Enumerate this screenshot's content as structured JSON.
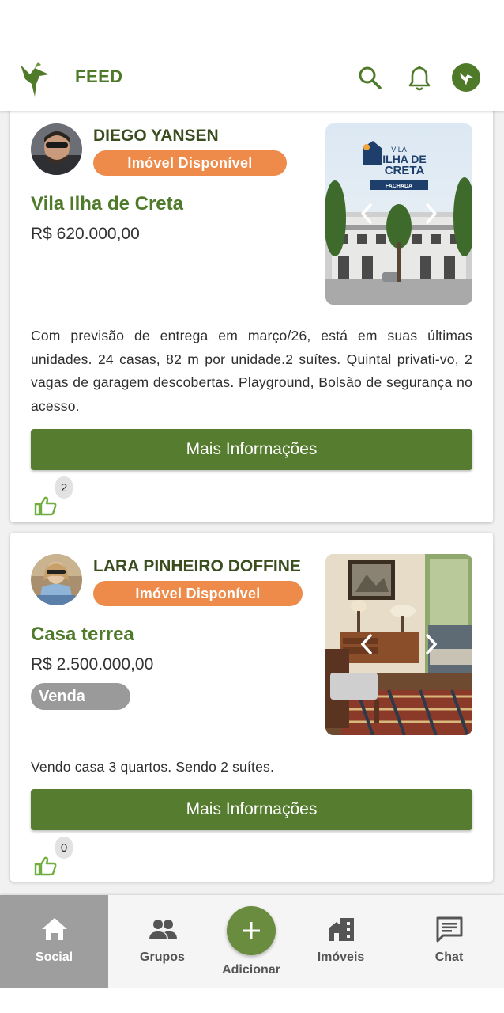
{
  "header": {
    "title": "FEED",
    "logo_icon": "hummingbird-logo",
    "search_icon": "search-icon",
    "notifications_icon": "bell-icon",
    "profile_icon": "profile-avatar-icon"
  },
  "posts": [
    {
      "author": "DIEGO YANSEN",
      "badge": "Imóvel Disponível",
      "title": "Vila Ilha de Creta",
      "price": "R$ 620.000,00",
      "photo_caption_small": "VILA",
      "photo_caption_large1": "ILHA DE",
      "photo_caption_large2": "CRETA",
      "photo_tag": "FACHADA",
      "description": "Com previsão de entrega em março/26, está em suas últimas unidades. 24 casas, 82 m por unidade.2 suítes. Quintal privati-vo, 2 vagas de garagem descobertas. Playground, Bolsão de segurança no acesso.",
      "button_label": "Mais Informações",
      "likes": "2"
    },
    {
      "author": "LARA PINHEIRO DOFFINE",
      "badge": "Imóvel Disponível",
      "title": "Casa terrea",
      "price": "R$ 2.500.000,00",
      "deal_type": "Venda",
      "description": "Vendo casa 3 quartos. Sendo 2 suítes.",
      "button_label": "Mais Informações",
      "likes": "0"
    }
  ],
  "bottom_nav": {
    "social": "Social",
    "grupos": "Grupos",
    "adicionar": "Adicionar",
    "imoveis": "Imóveis",
    "chat": "Chat",
    "active": "Social"
  },
  "colors": {
    "brand_green": "#567c2f",
    "badge_orange": "#ee8a4a",
    "pill_gray": "#9a9a9a",
    "active_nav": "#9e9e9e"
  }
}
